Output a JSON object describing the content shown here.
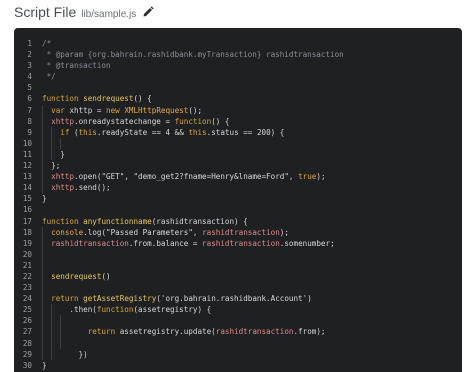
{
  "header": {
    "title": "Script File",
    "file_path": "lib/sample.js",
    "edit_icon": "pencil-icon"
  },
  "editor": {
    "lines": [
      {
        "n": "1",
        "indent": 0,
        "tokens": [
          [
            "cm",
            "/*"
          ]
        ]
      },
      {
        "n": "2",
        "indent": 0,
        "tokens": [
          [
            "cm",
            " * @param {org.bahrain.rashidbank.myTransaction} rashidtransaction"
          ]
        ]
      },
      {
        "n": "3",
        "indent": 0,
        "tokens": [
          [
            "cm",
            " * @transaction"
          ]
        ]
      },
      {
        "n": "4",
        "indent": 0,
        "tokens": [
          [
            "cm",
            " */"
          ]
        ]
      },
      {
        "n": "5",
        "indent": 0,
        "tokens": []
      },
      {
        "n": "6",
        "indent": 0,
        "tokens": [
          [
            "kw",
            "function "
          ],
          [
            "fn",
            "sendrequest"
          ],
          [
            "pl",
            "() {"
          ]
        ]
      },
      {
        "n": "7",
        "indent": 1,
        "tokens": [
          [
            "pl",
            "  "
          ],
          [
            "kw",
            "var "
          ],
          [
            "pl",
            "xhttp = "
          ],
          [
            "kw",
            "new "
          ],
          [
            "cls",
            "XMLHttpRequest"
          ],
          [
            "pl",
            "();"
          ]
        ]
      },
      {
        "n": "8",
        "indent": 1,
        "tokens": [
          [
            "pl",
            "  "
          ],
          [
            "vr",
            "xhttp"
          ],
          [
            "pl",
            ".onreadystatechange = "
          ],
          [
            "kw",
            "function"
          ],
          [
            "pl",
            "() {"
          ]
        ]
      },
      {
        "n": "9",
        "indent": 2,
        "tokens": [
          [
            "pl",
            "    "
          ],
          [
            "kw",
            "if "
          ],
          [
            "pl",
            "("
          ],
          [
            "kw",
            "this"
          ],
          [
            "pl",
            ".readyState == "
          ],
          [
            "num",
            "4"
          ],
          [
            "pl",
            " && "
          ],
          [
            "kw",
            "this"
          ],
          [
            "pl",
            ".status == "
          ],
          [
            "num",
            "200"
          ],
          [
            "pl",
            ") {"
          ]
        ]
      },
      {
        "n": "10",
        "indent": 3,
        "tokens": []
      },
      {
        "n": "11",
        "indent": 2,
        "tokens": [
          [
            "pl",
            "    }"
          ]
        ]
      },
      {
        "n": "12",
        "indent": 1,
        "tokens": [
          [
            "pl",
            "  };"
          ]
        ]
      },
      {
        "n": "13",
        "indent": 1,
        "tokens": [
          [
            "pl",
            "  "
          ],
          [
            "vr",
            "xhttp"
          ],
          [
            "pl",
            ".open("
          ],
          [
            "str",
            "\"GET\""
          ],
          [
            "pl",
            ", "
          ],
          [
            "str",
            "\"demo_get2?fname=Henry&lname=Ford\""
          ],
          [
            "pl",
            ", "
          ],
          [
            "kw",
            "true"
          ],
          [
            "pl",
            ");"
          ]
        ]
      },
      {
        "n": "14",
        "indent": 1,
        "tokens": [
          [
            "pl",
            "  "
          ],
          [
            "vr",
            "xhttp"
          ],
          [
            "pl",
            ".send();"
          ]
        ]
      },
      {
        "n": "15",
        "indent": 0,
        "tokens": [
          [
            "pl",
            "}"
          ]
        ]
      },
      {
        "n": "16",
        "indent": 0,
        "tokens": []
      },
      {
        "n": "17",
        "indent": 0,
        "tokens": [
          [
            "kw",
            "function "
          ],
          [
            "fn",
            "anyfunctionname"
          ],
          [
            "pl",
            "(rashidtransaction) {"
          ]
        ]
      },
      {
        "n": "18",
        "indent": 1,
        "tokens": [
          [
            "pl",
            "  "
          ],
          [
            "cls",
            "console"
          ],
          [
            "pl",
            ".log("
          ],
          [
            "str",
            "\"Passed Parameters\""
          ],
          [
            "pl",
            ", "
          ],
          [
            "vr",
            "rashidtransaction"
          ],
          [
            "pl",
            ");"
          ]
        ]
      },
      {
        "n": "19",
        "indent": 1,
        "tokens": [
          [
            "pl",
            "  "
          ],
          [
            "vr",
            "rashidtransaction"
          ],
          [
            "pl",
            ".from.balance = "
          ],
          [
            "vr",
            "rashidtransaction"
          ],
          [
            "pl",
            ".somenumber;"
          ]
        ]
      },
      {
        "n": "20",
        "indent": 1,
        "tokens": []
      },
      {
        "n": "21",
        "indent": 1,
        "tokens": []
      },
      {
        "n": "22",
        "indent": 1,
        "tokens": [
          [
            "pl",
            "  "
          ],
          [
            "fn",
            "sendrequest"
          ],
          [
            "pl",
            "()"
          ]
        ]
      },
      {
        "n": "23",
        "indent": 1,
        "tokens": []
      },
      {
        "n": "24",
        "indent": 1,
        "tokens": [
          [
            "pl",
            "  "
          ],
          [
            "kw",
            "return "
          ],
          [
            "fn",
            "getAssetRegistry"
          ],
          [
            "pl",
            "("
          ],
          [
            "str",
            "'org.bahrain.rashidbank.Account'"
          ],
          [
            "pl",
            ")"
          ]
        ]
      },
      {
        "n": "25",
        "indent": 2,
        "tokens": [
          [
            "pl",
            "      .then("
          ],
          [
            "kw",
            "function"
          ],
          [
            "pl",
            "(assetregistry) {"
          ]
        ]
      },
      {
        "n": "26",
        "indent": 3,
        "tokens": []
      },
      {
        "n": "27",
        "indent": 3,
        "tokens": [
          [
            "pl",
            "          "
          ],
          [
            "kw",
            "return "
          ],
          [
            "pl",
            "assetregistry.update("
          ],
          [
            "vr",
            "rashidtransaction"
          ],
          [
            "pl",
            ".from);"
          ]
        ]
      },
      {
        "n": "28",
        "indent": 3,
        "tokens": []
      },
      {
        "n": "29",
        "indent": 2,
        "tokens": [
          [
            "pl",
            "        })"
          ]
        ]
      },
      {
        "n": "30",
        "indent": 0,
        "tokens": [
          [
            "pl",
            "}"
          ]
        ]
      }
    ]
  }
}
